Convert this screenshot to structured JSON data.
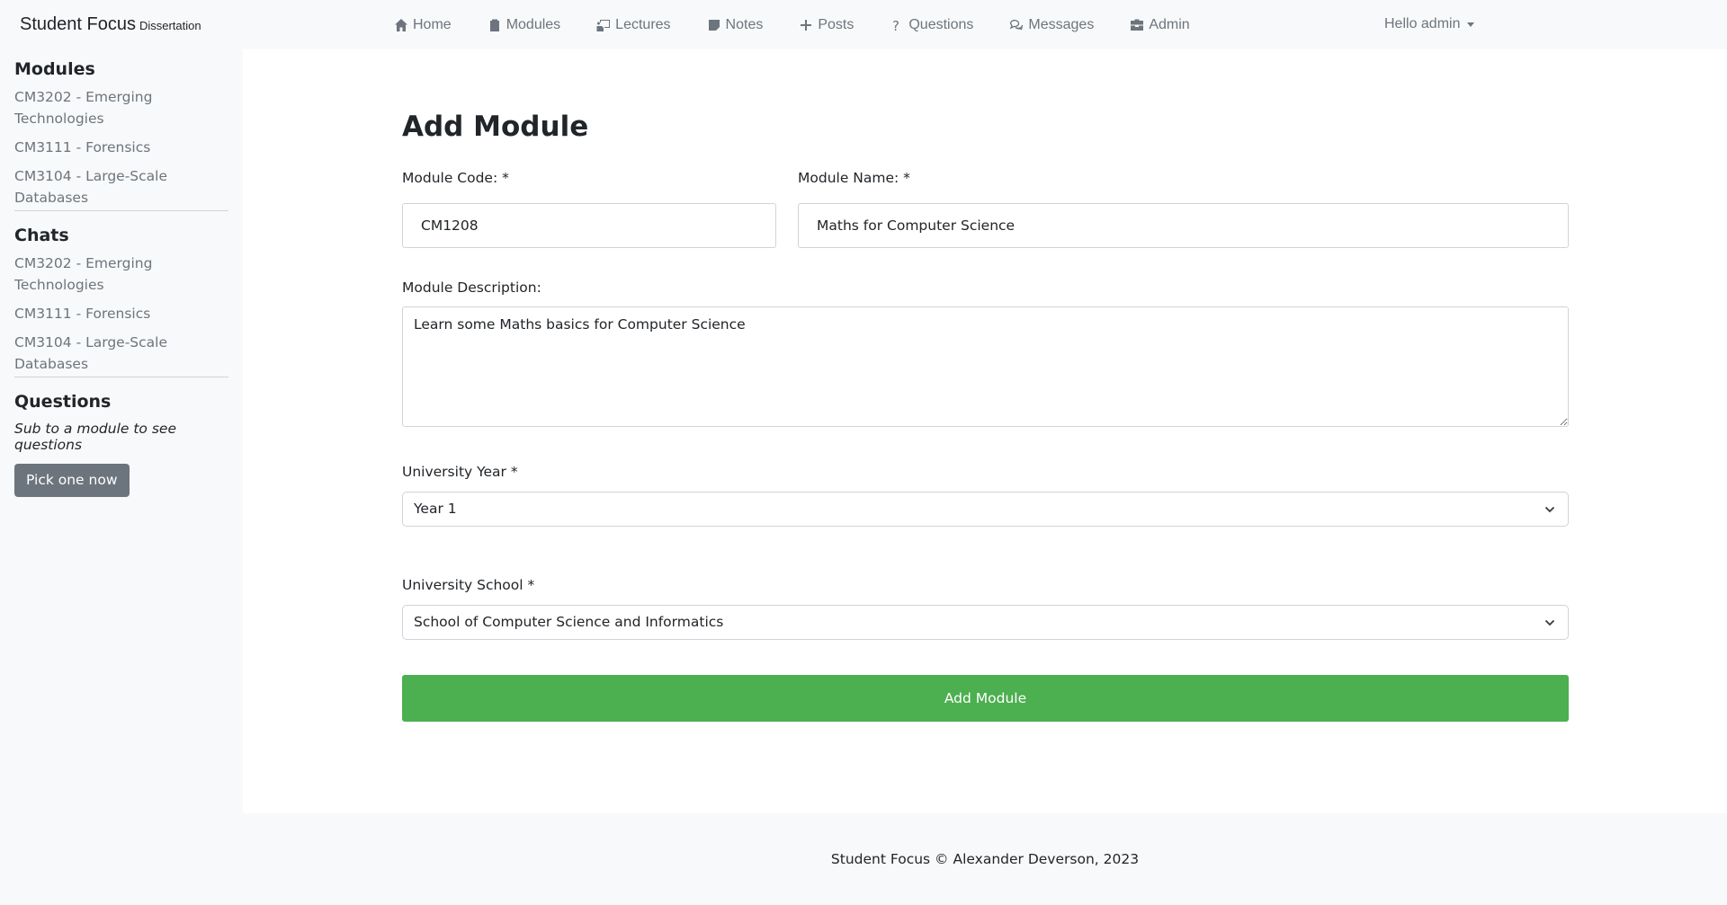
{
  "navbar": {
    "brand": "Student Focus",
    "brand_sub": "Dissertation",
    "items": [
      {
        "label": "Home",
        "icon": "home-icon"
      },
      {
        "label": "Modules",
        "icon": "clipboard-icon"
      },
      {
        "label": "Lectures",
        "icon": "lecture-icon"
      },
      {
        "label": "Notes",
        "icon": "note-icon"
      },
      {
        "label": "Posts",
        "icon": "plus-icon"
      },
      {
        "label": "Questions",
        "icon": "question-icon"
      },
      {
        "label": "Messages",
        "icon": "chat-icon"
      },
      {
        "label": "Admin",
        "icon": "toolbox-icon"
      }
    ],
    "user_menu": "Hello admin"
  },
  "sidebar": {
    "modules": {
      "title": "Modules",
      "items": [
        "CM3202 - Emerging Technologies",
        "CM3111 - Forensics",
        "CM3104 - Large-Scale Databases"
      ]
    },
    "chats": {
      "title": "Chats",
      "items": [
        "CM3202 - Emerging Technologies",
        "CM3111 - Forensics",
        "CM3104 - Large-Scale Databases"
      ]
    },
    "questions": {
      "title": "Questions",
      "note": "Sub to a module to see questions",
      "button": "Pick one now"
    }
  },
  "form": {
    "title": "Add Module",
    "code_label": "Module Code: *",
    "code_value": "CM1208",
    "name_label": "Module Name: *",
    "name_value": "Maths for Computer Science",
    "description_label": "Module Description:",
    "description_value": "Learn some Maths basics for Computer Science",
    "year_label": "University Year *",
    "year_value": "Year 1",
    "school_label": "University School *",
    "school_value": "School of Computer Science and Informatics",
    "submit": "Add Module"
  },
  "footer": {
    "text": "Student Focus © Alexander Deverson, 2023"
  }
}
